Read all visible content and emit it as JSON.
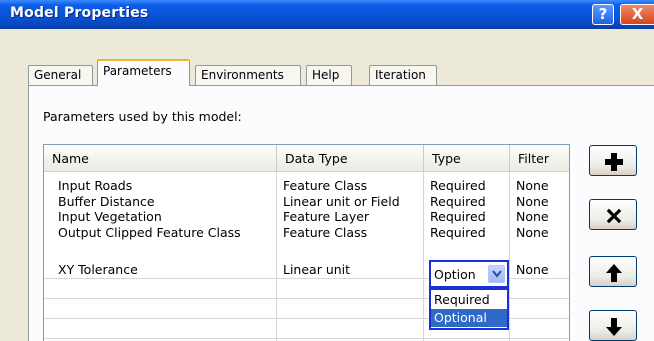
{
  "window": {
    "title": "Model Properties",
    "help_glyph": "?",
    "close_glyph": "X"
  },
  "tabs": [
    {
      "label": "General",
      "active": false
    },
    {
      "label": "Parameters",
      "active": true
    },
    {
      "label": "Environments",
      "active": false
    },
    {
      "label": "Help",
      "active": false
    },
    {
      "label": "Iteration",
      "active": false
    }
  ],
  "panel": {
    "caption": "Parameters used by this model:"
  },
  "table": {
    "columns": [
      "Name",
      "Data Type",
      "Type",
      "Filter"
    ],
    "rows": [
      {
        "name": "Input Roads",
        "data_type": "Feature Class",
        "type": "Required",
        "filter": "None"
      },
      {
        "name": "Buffer Distance",
        "data_type": "Linear unit or Field",
        "type": "Required",
        "filter": "None"
      },
      {
        "name": "Input Vegetation",
        "data_type": "Feature Layer",
        "type": "Required",
        "filter": "None"
      },
      {
        "name": "Output Clipped Feature Class",
        "data_type": "Feature Class",
        "type": "Required",
        "filter": "None"
      },
      {
        "name": "XY Tolerance",
        "data_type": "Linear unit",
        "type": "Option",
        "filter": "None"
      }
    ]
  },
  "type_dropdown": {
    "value": "Option",
    "options": [
      "Required",
      "Optional"
    ],
    "selected_option": "Optional"
  },
  "side_buttons": [
    {
      "icon": "plus-icon"
    },
    {
      "icon": "delete-x-icon"
    },
    {
      "icon": "arrow-up-icon"
    },
    {
      "icon": "arrow-down-icon"
    }
  ],
  "colors": {
    "titlebar": "#0a54d8",
    "active_tab_accent": "#f5b13a",
    "dropdown_border": "#1a2fd8",
    "selection": "#3169c6"
  }
}
